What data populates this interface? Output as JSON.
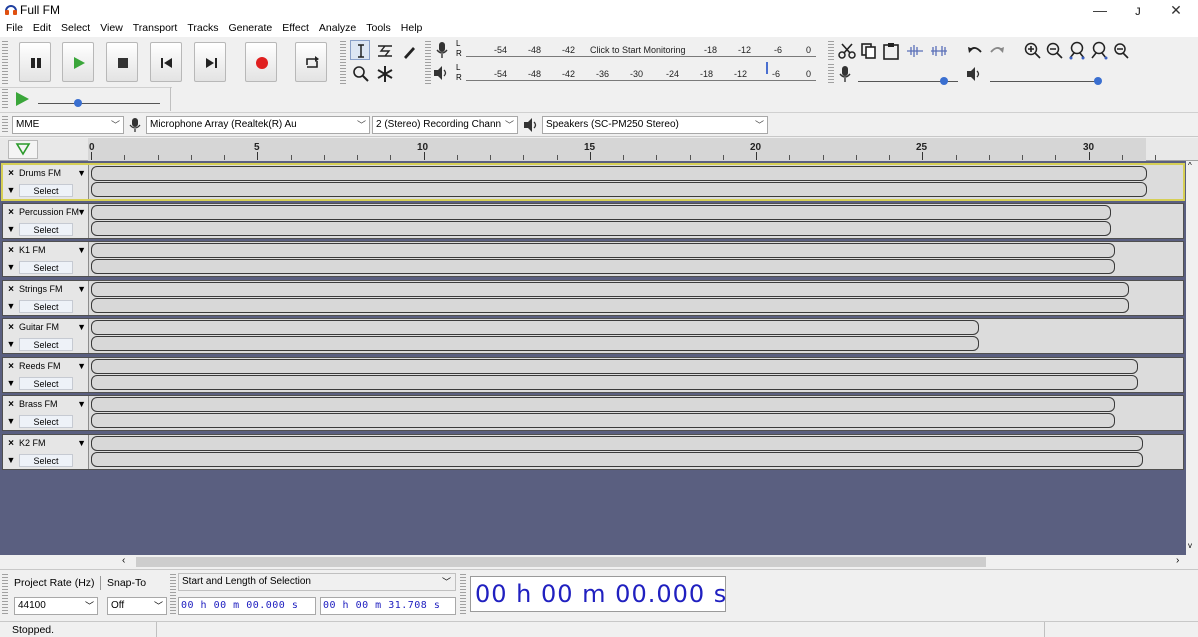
{
  "window": {
    "title": "Full FM",
    "minimize_glyph": "—",
    "restore_glyph": "ᴊ",
    "close_glyph": "✕"
  },
  "menu": [
    "File",
    "Edit",
    "Select",
    "View",
    "Transport",
    "Tracks",
    "Generate",
    "Effect",
    "Analyze",
    "Tools",
    "Help"
  ],
  "meters": {
    "record_ticks": [
      "-54",
      "-48",
      "-42",
      "-18",
      "-12",
      "-6",
      "0"
    ],
    "record_monitor_text": "Click to Start Monitoring",
    "play_ticks": [
      "-54",
      "-48",
      "-42",
      "-36",
      "-30",
      "-24",
      "-18",
      "-12",
      "-6",
      "0"
    ],
    "lr": [
      "L",
      "R"
    ]
  },
  "devices": {
    "host": "MME",
    "mic": "Microphone Array (Realtek(R) Au",
    "channels": "2 (Stereo) Recording Chann",
    "speaker": "Speakers (SC-PM250 Stereo)"
  },
  "ruler": {
    "labels": [
      "0",
      "5",
      "10",
      "15",
      "20",
      "25",
      "30"
    ]
  },
  "tracks": [
    {
      "name": "Drums FM",
      "select": "Select"
    },
    {
      "name": "Percussion FM",
      "select": "Select"
    },
    {
      "name": "K1 FM",
      "select": "Select"
    },
    {
      "name": "Strings FM",
      "select": "Select"
    },
    {
      "name": "Guitar FM",
      "select": "Select"
    },
    {
      "name": "Reeds FM",
      "select": "Select"
    },
    {
      "name": "Brass FM",
      "select": "Select"
    },
    {
      "name": "K2 FM",
      "select": "Select"
    }
  ],
  "selection": {
    "project_rate_label": "Project Rate (Hz)",
    "snap_label": "Snap-To",
    "rate_value": "44100",
    "snap_value": "Off",
    "mode_label": "Start and Length of Selection",
    "start_time": "00 h 00 m 00.000 s",
    "length_time": "00 h 00 m 31.708 s",
    "big_time": "00 h 00 m 00.000 s"
  },
  "status": {
    "text": "Stopped."
  },
  "colors": {
    "track_bg": "#5a5f80",
    "time_text": "#2020c0",
    "record_red": "#e02020",
    "play_green": "#3aa63a",
    "selected_outline": "#d6cf55"
  }
}
